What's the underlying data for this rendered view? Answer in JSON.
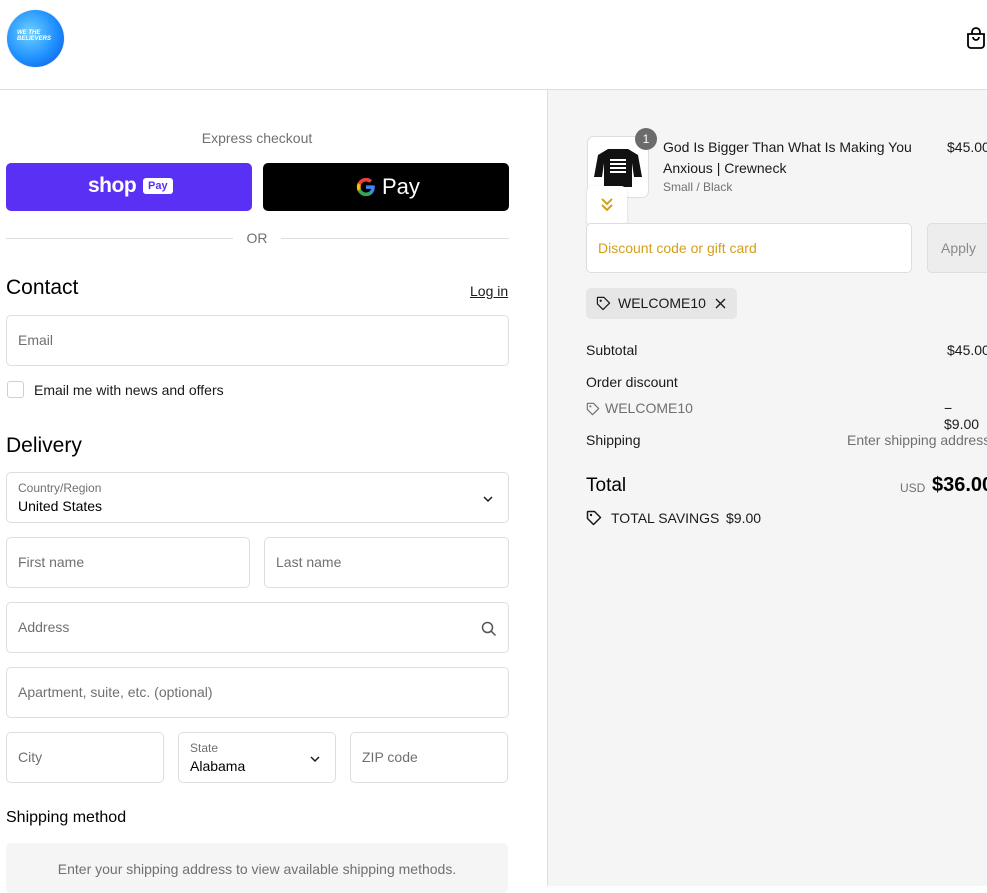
{
  "header": {
    "logo_text": "WE THE BELIEVERS",
    "cart_icon": "shopping-bag-icon"
  },
  "express": {
    "label": "Express checkout",
    "shop_pay": {
      "word": "shop",
      "badge": "Pay",
      "color": "#5a31f4"
    },
    "google_pay": {
      "word": "Pay",
      "icon": "google-g-icon"
    },
    "or_text": "OR"
  },
  "contact": {
    "title": "Contact",
    "login_link": "Log in",
    "email_placeholder": "Email",
    "news_checkbox_label": "Email me with news and offers",
    "news_checked": false
  },
  "delivery": {
    "title": "Delivery",
    "country_label": "Country/Region",
    "country_value": "United States",
    "first_name_placeholder": "First name",
    "last_name_placeholder": "Last name",
    "address_placeholder": "Address",
    "apartment_placeholder": "Apartment, suite, etc. (optional)",
    "city_placeholder": "City",
    "state_label": "State",
    "state_value": "Alabama",
    "zip_placeholder": "ZIP code"
  },
  "shipping_method": {
    "title": "Shipping method",
    "note": "Enter your shipping address to view available shipping methods."
  },
  "order": {
    "item": {
      "quantity": "1",
      "title": "God Is Bigger Than What Is Making You Anxious | Crewneck",
      "variant": "Small / Black",
      "price": "$45.00",
      "image_text": "GOD IS BIGGER THAN WHAT IS MAKING YOU ANXIOUS"
    },
    "discount_placeholder": "Discount code or gift card",
    "apply_label": "Apply",
    "applied_code": "WELCOME10",
    "subtotal_label": "Subtotal",
    "subtotal_value": "$45.00",
    "order_discount_label": "Order discount",
    "discount_code": "WELCOME10",
    "discount_value": "− $9.00",
    "shipping_label": "Shipping",
    "shipping_value": "Enter shipping address",
    "total_label": "Total",
    "currency": "USD",
    "total_value": "$36.00",
    "savings_label": "TOTAL SAVINGS",
    "savings_value": "$9.00"
  },
  "colors": {
    "accent_gold": "#d4a017",
    "shop_pay_purple": "#5a31f4",
    "panel_bg": "#f5f5f5"
  }
}
